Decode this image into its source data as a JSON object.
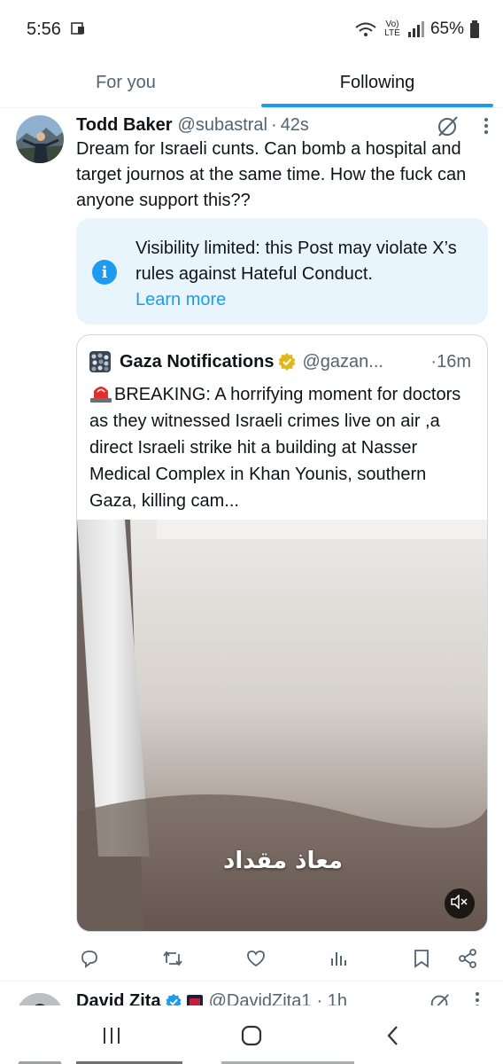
{
  "status_bar": {
    "time": "5:56",
    "battery": "65%",
    "network": "Vo) LTE"
  },
  "tabs": [
    {
      "label": "For you",
      "active": false
    },
    {
      "label": "Following",
      "active": true
    }
  ],
  "tweet": {
    "author_name": "Todd Baker",
    "author_handle": "@subastral",
    "separator": "·",
    "time": "42s",
    "text": "Dream for Israeli cunts. Can bomb a hospital and target journos at the same time. How the fuck can anyone support this??",
    "notice": {
      "text": "Visibility limited: this Post may violate X’s rules against Hateful Conduct.",
      "link": "Learn more",
      "icon": "info-icon"
    },
    "quote": {
      "author_name": "Gaza Notifications",
      "author_handle": "@gazan...",
      "time": "·16m",
      "text": "BREAKING: A horrifying moment for doctors as they witnessed Israeli crimes live on air ,a direct Israeli strike hit a building at Nasser Medical Complex in Khan Younis, southern Gaza, killing cam...",
      "video_caption": "معاذ مقداد"
    }
  },
  "next_tweet": {
    "author_name": "David Zita",
    "author_handle": "@DavidZita1",
    "time": "· 1h"
  },
  "colors": {
    "accent": "#1d9bf0",
    "secondary_text": "#536471",
    "notice_bg": "#e8f5fd"
  }
}
